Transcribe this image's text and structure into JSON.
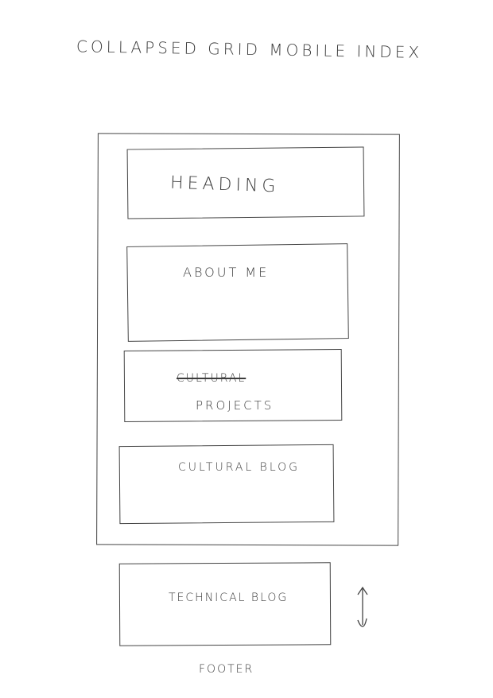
{
  "title": "COLLAPSED GRID MOBILE INDEX",
  "sections": {
    "heading": "HEADING",
    "about": "ABOUT ME",
    "projects_struck": "CULTURAL",
    "projects": "PROJECTS",
    "blog": "CULTURAL BLOG",
    "technical_blog": "TECHNICAL BLOG",
    "footer": "FOOTER"
  },
  "icons": {
    "scroll": "up-down-arrow-icon"
  },
  "colors": {
    "ink": "#3c3c3c",
    "paper": "#ffffff"
  }
}
